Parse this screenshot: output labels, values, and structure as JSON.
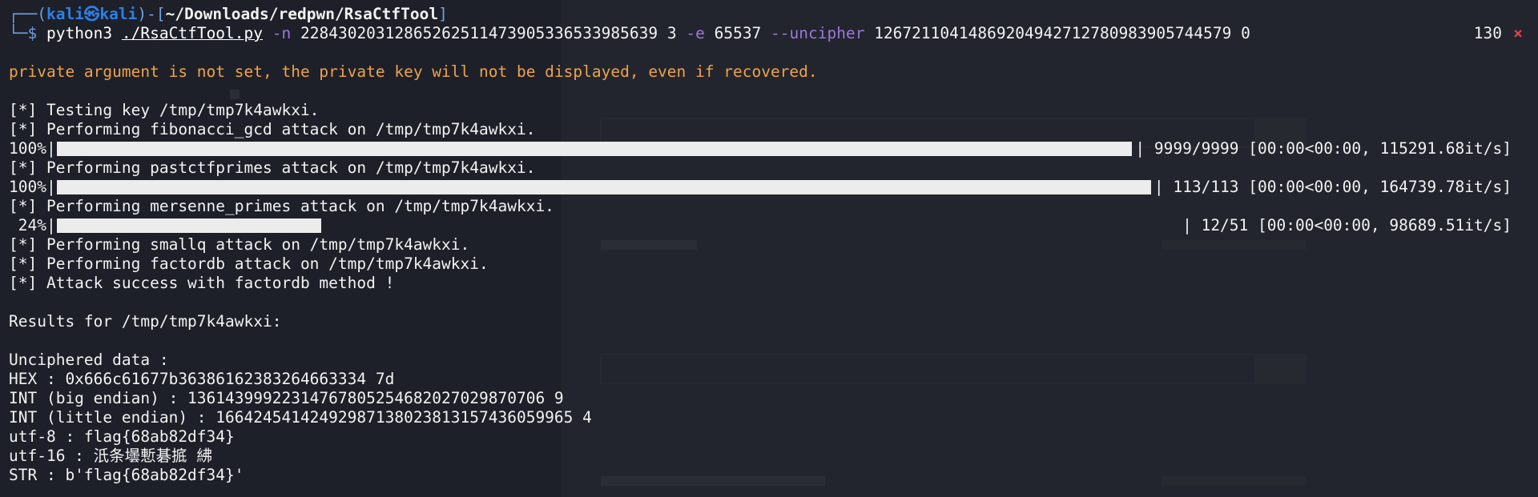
{
  "prompt": {
    "open": "┌──(",
    "user": "kali㉿kali",
    "mid": ")-[",
    "path": "~/Downloads/redpwn/RsaCtfTool",
    "close": "]",
    "second": "└─$ "
  },
  "command": {
    "program": "python3",
    "script": "./RsaCtfTool.py",
    "n_flag": "-n",
    "n_value": "22843020312865262511473905336533985639 3",
    "e_flag": "-e",
    "e_value": "65537",
    "uncipher_flag": "--uncipher",
    "uncipher_value": "12672110414869204942712780983905744579 0"
  },
  "status": {
    "code": "130",
    "mark": "×"
  },
  "warning": "private argument is not set, the private key will not be displayed, even if recovered.",
  "log": [
    "[*] Testing key /tmp/tmp7k4awkxi.",
    "[*] Performing fibonacci_gcd attack on /tmp/tmp7k4awkxi.",
    "[*] Performing pastctfprimes attack on /tmp/tmp7k4awkxi.",
    "[*] Performing mersenne_primes attack on /tmp/tmp7k4awkxi.",
    "[*] Performing smallq attack on /tmp/tmp7k4awkxi.",
    "[*] Performing factordb attack on /tmp/tmp7k4awkxi.",
    "[*] Attack success with factordb method !"
  ],
  "progress": [
    {
      "pct_label": "100%|",
      "fraction": 1.0,
      "stats": "| 9999/9999 [00:00<00:00, 115291.68it/s]"
    },
    {
      "pct_label": "100%|",
      "fraction": 1.0,
      "stats": "| 113/113 [00:00<00:00, 164739.78it/s]"
    },
    {
      "pct_label": " 24%|",
      "fraction": 0.24,
      "stats": "| 12/51 [00:00<00:00, 98689.51it/s]"
    }
  ],
  "results": {
    "header": "Results for /tmp/tmp7k4awkxi:",
    "unciphered_label": "Unciphered data :",
    "hex": "HEX : 0x666c61677b36386162383264663334 7d",
    "int_big": "INT (big endian) : 13614399922314767805254682027029870706 9",
    "int_little": "INT (little endian) : 16642454142492987138023813157436059965 4",
    "utf8": "utf-8 : flag{68ab82df34}",
    "utf16": "utf-16 : 汦条壜慙碁掋 紼",
    "str": "STR : b'flag{68ab82df34}'"
  }
}
